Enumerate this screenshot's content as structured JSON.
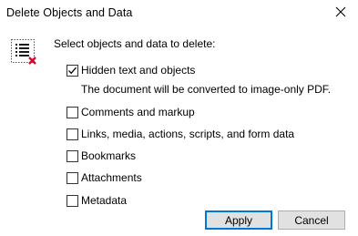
{
  "window": {
    "title": "Delete Objects and Data"
  },
  "icons": {
    "app": "list-delete-icon",
    "close": "close-icon",
    "check": "check-icon"
  },
  "prompt": "Select objects and data to delete:",
  "options": [
    {
      "label": "Hidden text and objects",
      "checked": true
    },
    {
      "label": "Comments and markup",
      "checked": false
    },
    {
      "label": "Links, media, actions, scripts, and form data",
      "checked": false
    },
    {
      "label": "Bookmarks",
      "checked": false
    },
    {
      "label": "Attachments",
      "checked": false
    },
    {
      "label": "Metadata",
      "checked": false
    }
  ],
  "hidden_text_note": "The document will be converted to image-only PDF.",
  "buttons": {
    "apply": "Apply",
    "cancel": "Cancel"
  },
  "colors": {
    "accent": "#0078d7",
    "delete_mark": "#c8102e",
    "button_face": "#e1e1e1"
  }
}
